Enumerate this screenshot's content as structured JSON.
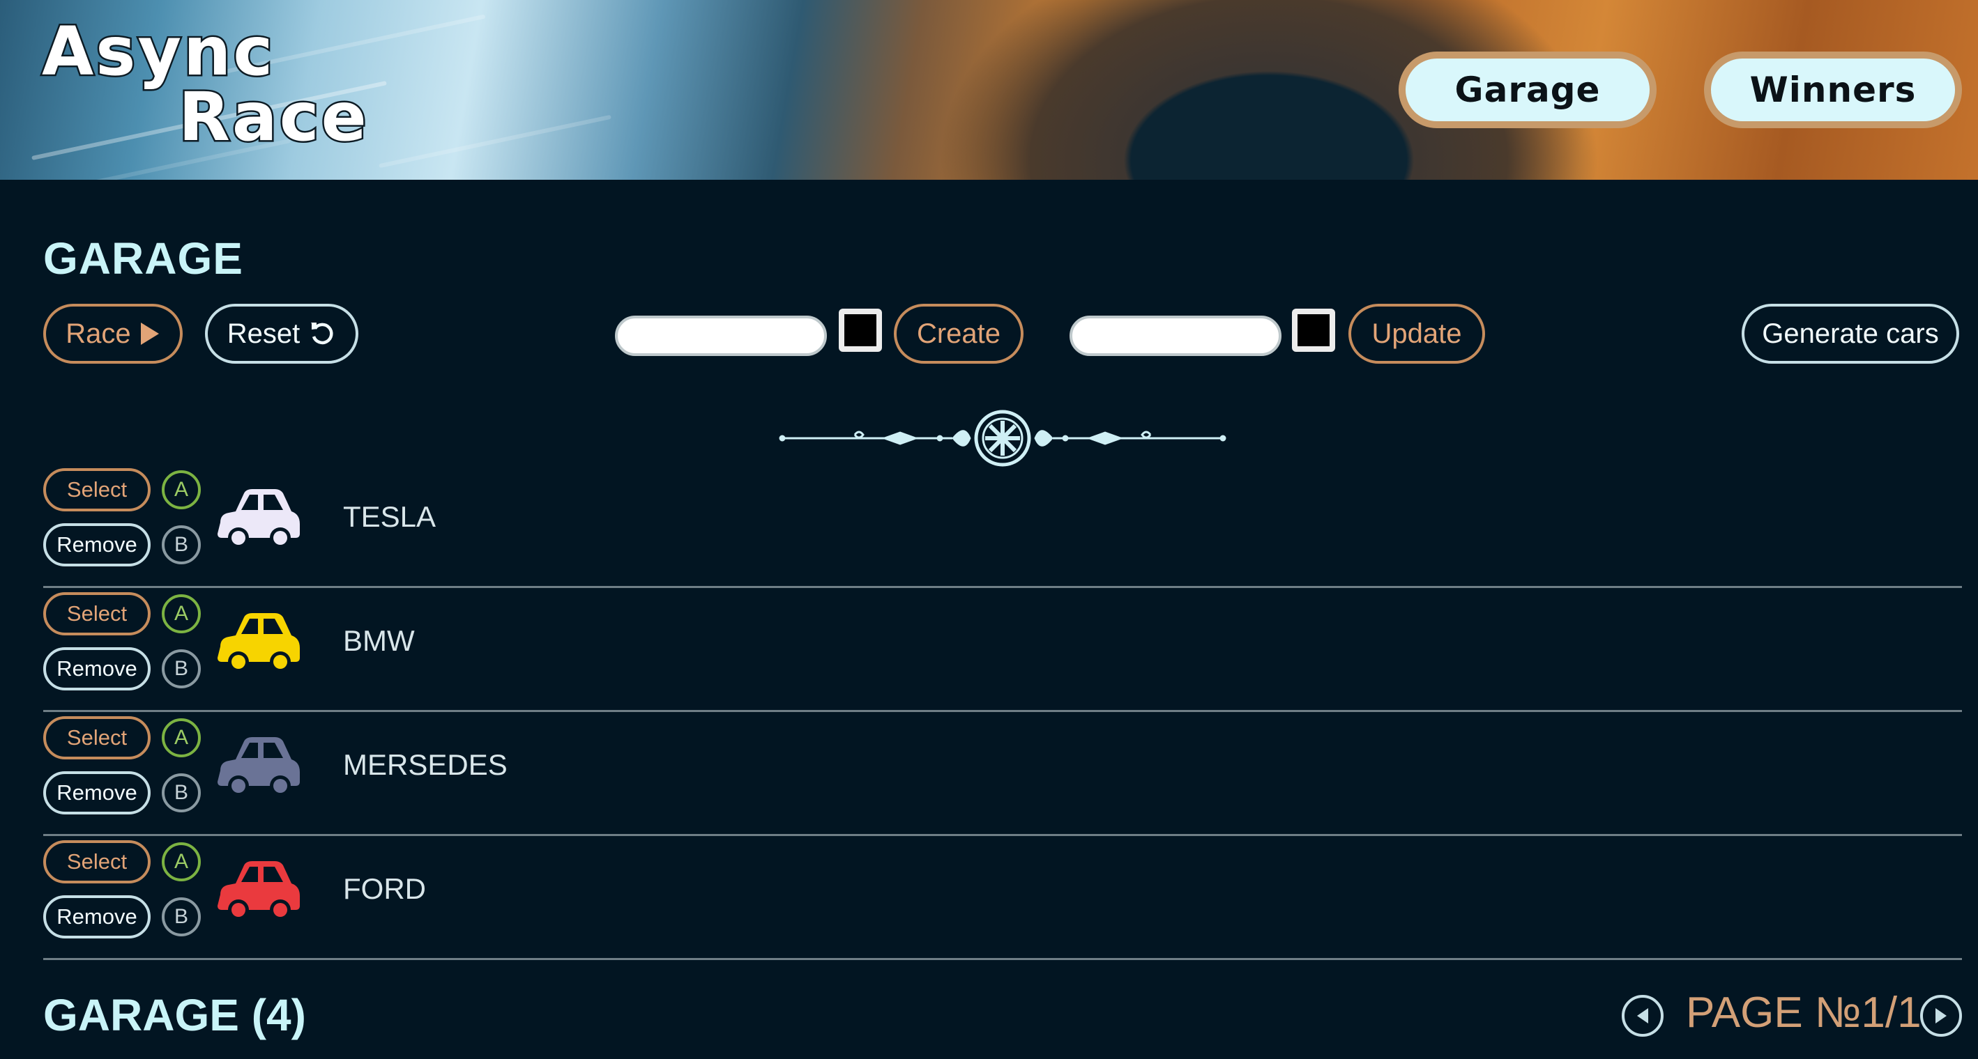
{
  "header": {
    "logo_line1": "Async",
    "logo_line2": "Race",
    "nav": {
      "garage_label": "Garage",
      "winners_label": "Winners"
    }
  },
  "garage": {
    "title": "GARAGE",
    "controls": {
      "race_label": "Race",
      "reset_label": "Reset",
      "create_label": "Create",
      "update_label": "Update",
      "generate_label": "Generate cars",
      "create_input_value": "",
      "update_input_value": "",
      "create_color": "#000000",
      "update_color": "#000000"
    },
    "row_buttons": {
      "select_label": "Select",
      "remove_label": "Remove",
      "a_label": "A",
      "b_label": "B"
    },
    "cars": [
      {
        "name": "TESLA",
        "color": "#ece8f8"
      },
      {
        "name": "BMW",
        "color": "#f7d400"
      },
      {
        "name": "MERSEDES",
        "color": "#6a7396"
      },
      {
        "name": "FORD",
        "color": "#ea3a3e"
      }
    ],
    "count_label": "GARAGE (4)",
    "page_label": "PAGE №1/1"
  },
  "colors": {
    "background": "#021522",
    "accent_orange": "#c68c5c",
    "title_cyan": "#c9f4f8"
  },
  "icons": {
    "race": "play-icon",
    "reset": "reset-arrow-icon",
    "car": "car-icon",
    "prev": "prev-arrow-icon",
    "next": "next-arrow-icon"
  }
}
